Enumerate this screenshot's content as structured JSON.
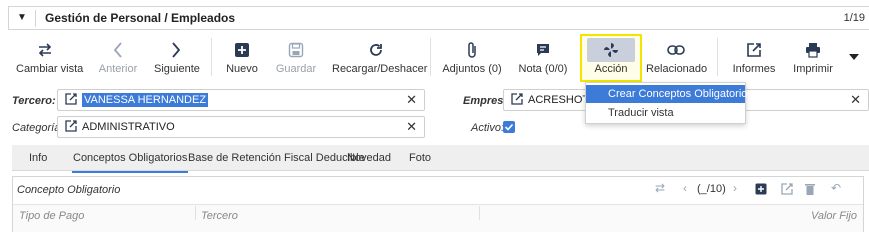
{
  "titlebar": {
    "title": "Gestión de Personal / Empleados",
    "pager": "1/19"
  },
  "toolbar": {
    "cambiar_vista": "Cambiar vista",
    "anterior": "Anterior",
    "siguiente": "Siguiente",
    "nuevo": "Nuevo",
    "guardar": "Guardar",
    "recargar": "Recargar/Deshacer",
    "adjuntos": "Adjuntos (0)",
    "nota": "Nota (0/0)",
    "accion": "Acción",
    "relacionado": "Relacionado",
    "informes": "Informes",
    "imprimir": "Imprimir"
  },
  "form": {
    "tercero_label": "Tercero:",
    "tercero_value": "VANESSA HERNANDEZ",
    "categoria_label": "Categoría:",
    "categoria_value": "ADMINISTRATIVO",
    "empresa_label": "Empresa:",
    "empresa_value": "ACRESHOTEL",
    "activo_label": "Activo:"
  },
  "dropdown": {
    "items": [
      "Crear Conceptos Obligatorios",
      "Traducir vista"
    ]
  },
  "tabs": [
    "Info",
    "Conceptos Obligatorios",
    "Base de Retención Fiscal Deducible",
    "Novedad",
    "Foto"
  ],
  "grid": {
    "title": "Concepto Obligatorio",
    "pager": "(_/10)",
    "columns": [
      "Tipo de Pago",
      "Tercero",
      "Valor Fijo"
    ]
  }
}
